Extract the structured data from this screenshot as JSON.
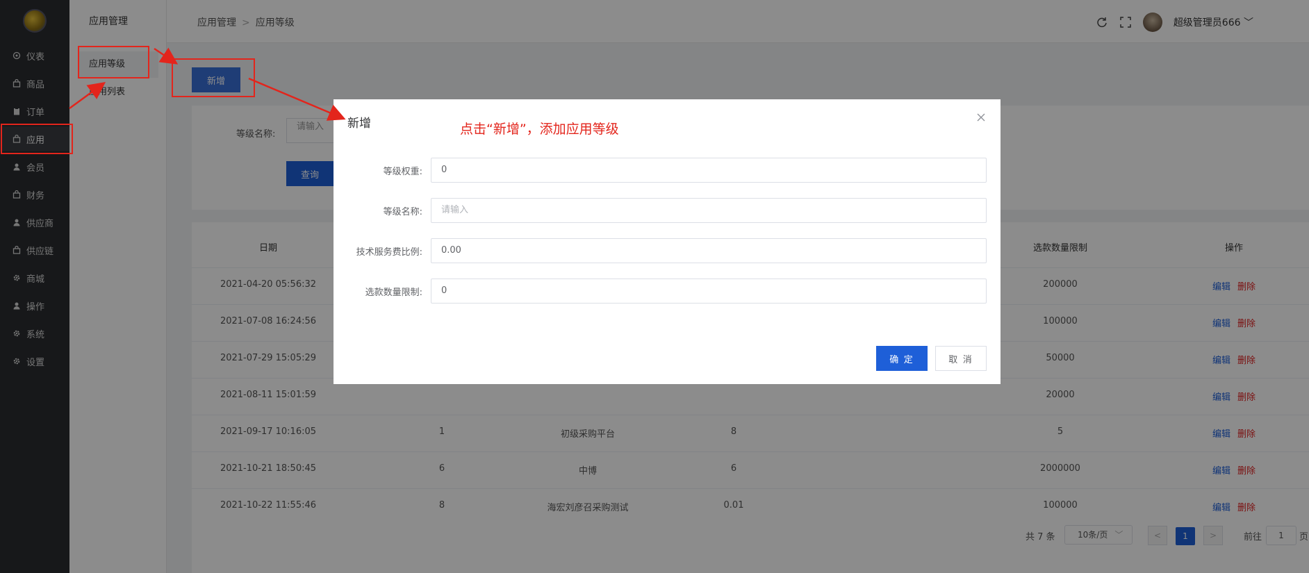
{
  "sidebar": {
    "items": [
      {
        "label": "仪表",
        "icon": "dashboard-icon"
      },
      {
        "label": "商品",
        "icon": "bag-icon"
      },
      {
        "label": "订单",
        "icon": "clipboard-icon"
      },
      {
        "label": "应用",
        "icon": "bag-icon",
        "active": true
      },
      {
        "label": "会员",
        "icon": "user-icon"
      },
      {
        "label": "财务",
        "icon": "bag-icon"
      },
      {
        "label": "供应商",
        "icon": "user-icon"
      },
      {
        "label": "供应链",
        "icon": "bag-icon"
      },
      {
        "label": "商城",
        "icon": "gear-icon"
      },
      {
        "label": "操作",
        "icon": "user-icon"
      },
      {
        "label": "系统",
        "icon": "gear-icon"
      },
      {
        "label": "设置",
        "icon": "gear-icon"
      }
    ]
  },
  "subsidebar": {
    "title": "应用管理",
    "items": [
      "应用等级",
      "应用列表"
    ]
  },
  "header": {
    "breadcrumb": [
      "应用管理",
      "应用等级"
    ],
    "username": "超级管理员666"
  },
  "toolbar": {
    "add_label": "新增"
  },
  "filter": {
    "label": "等级名称:",
    "placeholder": "请输入",
    "query_label": "查询"
  },
  "table": {
    "headers": [
      "日期",
      "",
      "",
      "",
      "选款数量限制",
      "操作"
    ],
    "rows": [
      [
        "2021-04-20 05:56:32",
        "",
        "",
        "",
        "200000"
      ],
      [
        "2021-07-08 16:24:56",
        "",
        "",
        "",
        "100000"
      ],
      [
        "2021-07-29 15:05:29",
        "",
        "",
        "",
        "50000"
      ],
      [
        "2021-08-11 15:01:59",
        "",
        "",
        "",
        "20000"
      ],
      [
        "2021-09-17 10:16:05",
        "1",
        "初级采购平台",
        "8",
        "5"
      ],
      [
        "2021-10-21 18:50:45",
        "6",
        "中博",
        "6",
        "2000000"
      ],
      [
        "2021-10-22 11:55:46",
        "8",
        "海宏刘彦召采购测试",
        "0.01",
        "100000"
      ]
    ],
    "edit_label": "编辑",
    "delete_label": "删除"
  },
  "pagination": {
    "total": "共 7 条",
    "page_size": "10条/页",
    "current": "1",
    "goto_prefix": "前往",
    "goto_value": "1",
    "goto_suffix": "页"
  },
  "modal": {
    "title": "新增",
    "annotation": "点击“新增”，添加应用等级",
    "fields": [
      {
        "label": "等级权重:",
        "value": "0",
        "placeholder": ""
      },
      {
        "label": "等级名称:",
        "value": "",
        "placeholder": "请输入"
      },
      {
        "label": "技术服务费比例:",
        "value": "0.00",
        "placeholder": ""
      },
      {
        "label": "选款数量限制:",
        "value": "0",
        "placeholder": ""
      }
    ],
    "ok_label": "确 定",
    "cancel_label": "取 消"
  },
  "colors": {
    "primary": "#1e5fd8",
    "danger": "#e02020",
    "annotation": "#e3251c",
    "sidebar_bg": "#2b2d31"
  }
}
